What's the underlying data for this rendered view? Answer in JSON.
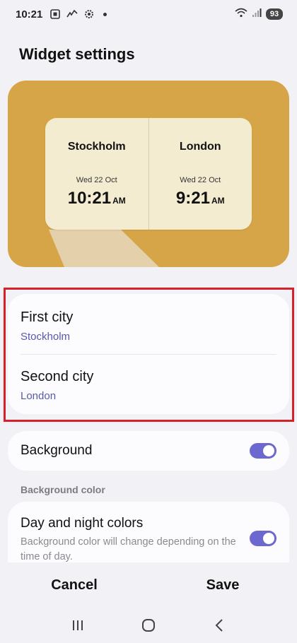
{
  "status_bar": {
    "time": "10:21",
    "battery": "93",
    "icons": [
      "screenshot-icon",
      "missed-call-icon",
      "settings-gear-icon",
      "notification-dot-icon",
      "wifi-icon",
      "signal-icon",
      "battery-icon"
    ]
  },
  "page": {
    "title": "Widget settings"
  },
  "preview": {
    "background_color": "#d6a548",
    "cities": [
      {
        "name": "Stockholm",
        "date": "Wed 22 Oct",
        "time": "10:21",
        "ampm": "AM"
      },
      {
        "name": "London",
        "date": "Wed 22 Oct",
        "time": "9:21",
        "ampm": "AM"
      }
    ]
  },
  "settings": {
    "first_city": {
      "label": "First city",
      "value": "Stockholm"
    },
    "second_city": {
      "label": "Second city",
      "value": "London"
    },
    "background": {
      "label": "Background",
      "enabled": true
    },
    "background_color_section": "Background color",
    "day_night": {
      "label": "Day and night colors",
      "description": "Background color will change depending on the time of day.",
      "enabled": true
    }
  },
  "actions": {
    "cancel": "Cancel",
    "save": "Save"
  },
  "navbar": {
    "icons": [
      "recent-apps-icon",
      "home-icon",
      "back-icon"
    ]
  },
  "colors": {
    "accent": "#6d68cf",
    "highlight": "#d8202a",
    "subtext": "#5a58a8"
  }
}
